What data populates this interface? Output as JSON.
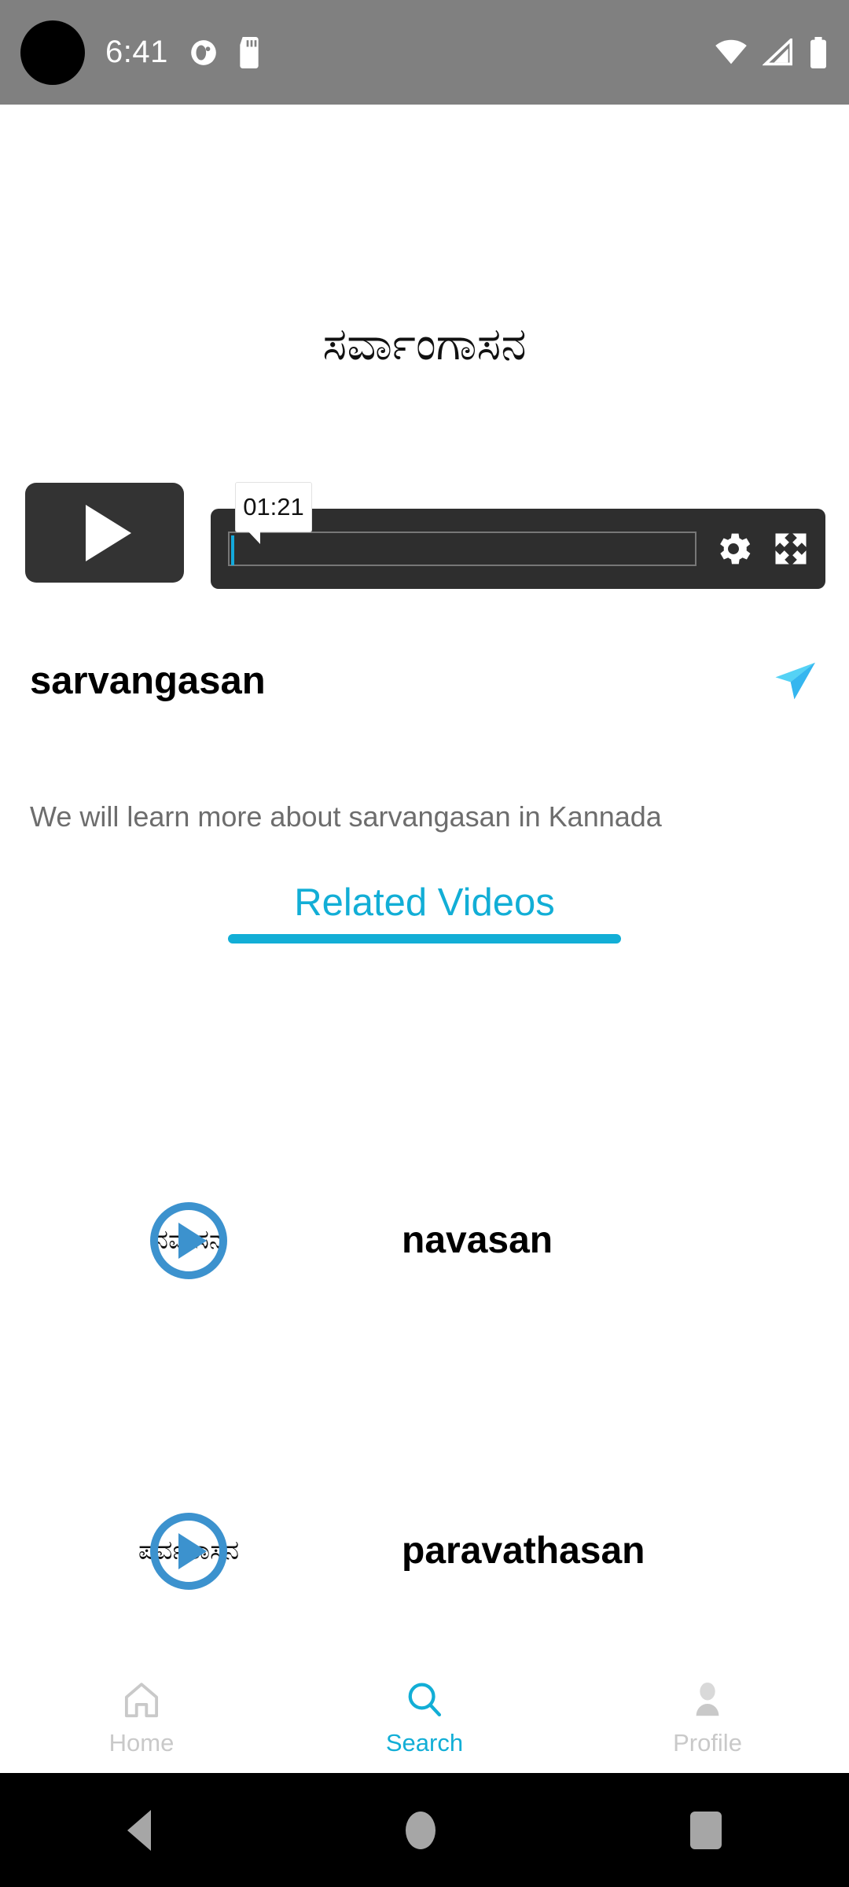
{
  "statusbar": {
    "time": "6:41",
    "left_icons": [
      "badge-circle-icon",
      "sd-card-icon"
    ],
    "right_icons": [
      "wifi-icon",
      "cellular-signal-icon",
      "battery-icon"
    ],
    "background": "#808080"
  },
  "video": {
    "title_kn": "ಸರ್ವಾಂಗಾಸನ",
    "title": "sarvangasan",
    "description": "We will learn more about sarvangasan in Kannada",
    "current_time": "01:21",
    "progress_percent": 0,
    "play_icon": "play-icon",
    "settings_icon": "gear-icon",
    "fullscreen_icon": "fullscreen-icon",
    "share_icon": "send-plane-icon"
  },
  "tabs": [
    {
      "label": "Related Videos",
      "active": true
    }
  ],
  "related_videos": [
    {
      "thumb_text": "ನವಾಸನ",
      "label": "navasan",
      "play_icon": "play-circle-icon"
    },
    {
      "thumb_text": "ಪರ್ವತಾಸನ",
      "label": "paravathasan",
      "play_icon": "play-circle-icon"
    }
  ],
  "bottom_nav": [
    {
      "label": "Home",
      "icon": "home-icon",
      "active": false
    },
    {
      "label": "Search",
      "icon": "search-icon",
      "active": true
    },
    {
      "label": "Profile",
      "icon": "person-icon",
      "active": false
    }
  ],
  "system_nav": {
    "back": "back-triangle-icon",
    "home": "home-circle-icon",
    "recents": "recents-square-icon"
  },
  "colors": {
    "accent": "#12aed6",
    "play_circle": "#3c92ce",
    "player_dark": "#333333",
    "statusbar_gray": "#808080",
    "muted_text": "#6d6d6d",
    "nav_inactive": "#c9c9c9"
  }
}
